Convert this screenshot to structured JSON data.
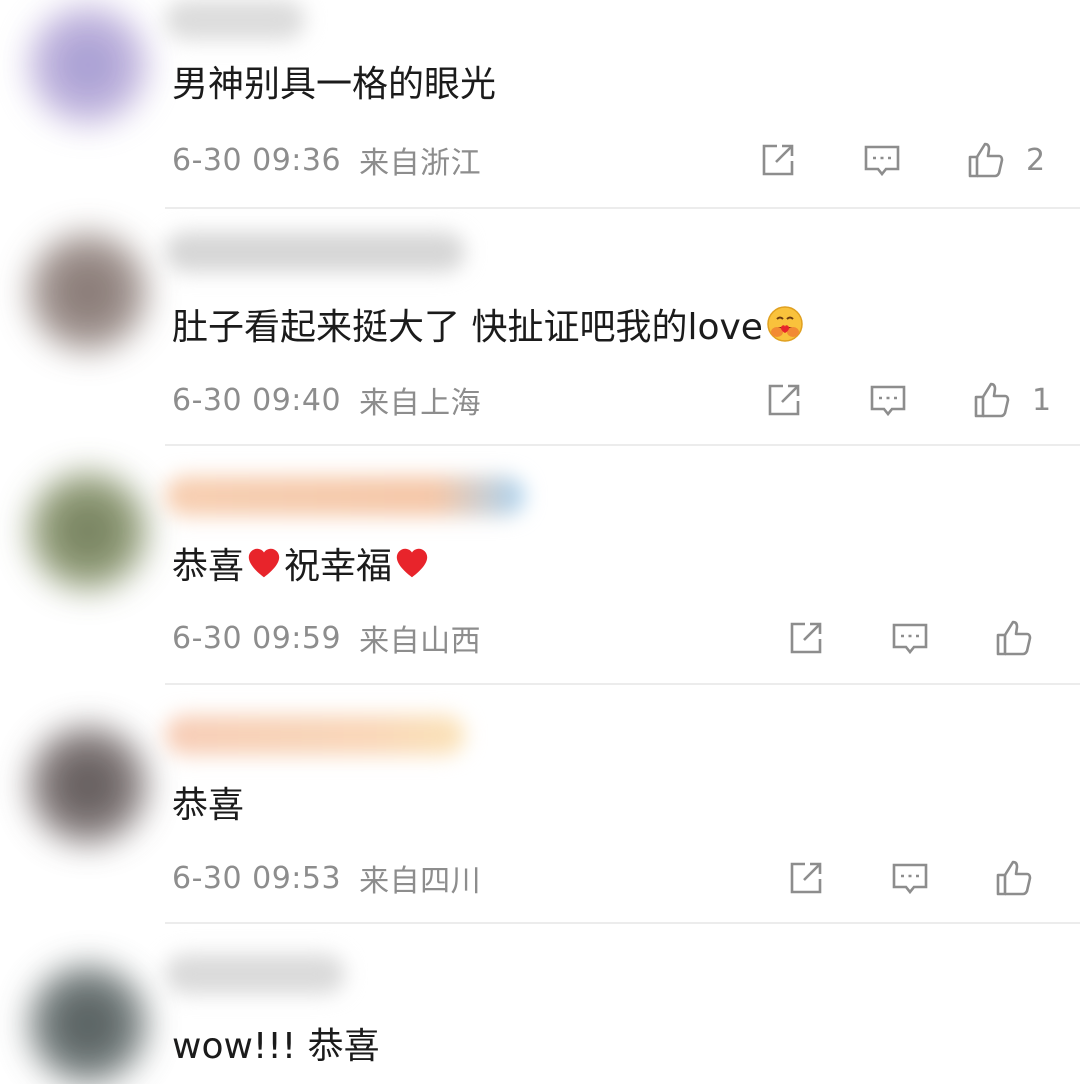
{
  "comments": [
    {
      "text": "男神别具一格的眼光",
      "time": "6-30 09:36",
      "location": "来自浙江",
      "likes": "2"
    },
    {
      "text": "肚子看起来挺大了 快扯证吧我的love",
      "time": "6-30 09:40",
      "location": "来自上海",
      "likes": "1"
    },
    {
      "text_a": "恭喜",
      "text_b": "祝幸福",
      "time": "6-30 09:59",
      "location": "来自山西",
      "likes": ""
    },
    {
      "text": "恭喜",
      "time": "6-30 09:53",
      "location": "来自四川",
      "likes": ""
    },
    {
      "text": "wow!!! 恭喜"
    }
  ],
  "icons": {
    "share": "share-icon",
    "reply": "comment-icon",
    "like": "thumbs-up-icon",
    "emoji": "hug-face-emoji",
    "heart": "red-heart-emoji"
  },
  "colors": {
    "text": "#1b1b1b",
    "meta": "#8d8d8d",
    "divider": "#ececec",
    "heart": "#e8242b"
  }
}
